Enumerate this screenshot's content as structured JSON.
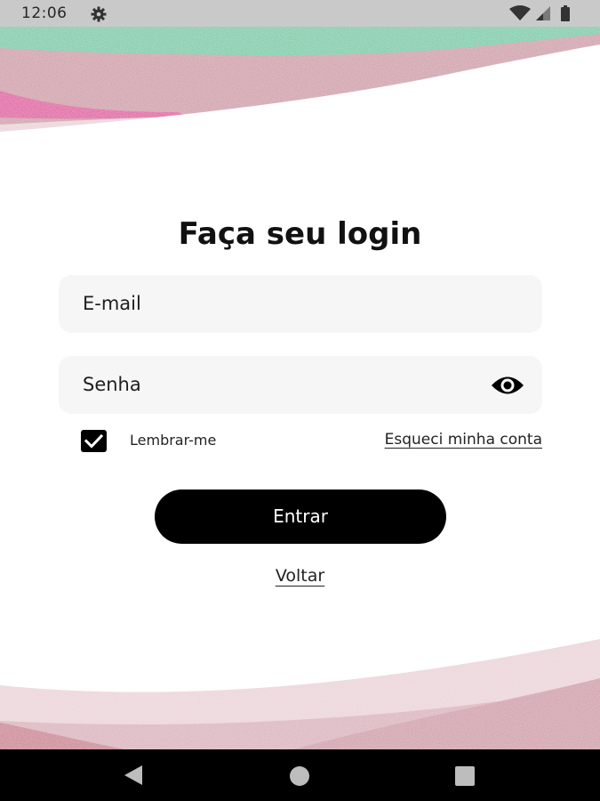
{
  "status_bar": {
    "time": "12:06",
    "icons": [
      "settings-gear-icon",
      "wifi-icon",
      "signal-icon",
      "battery-icon"
    ]
  },
  "login": {
    "title": "Faça seu login",
    "email_placeholder": "E-mail",
    "password_placeholder": "Senha",
    "remember_label": "Lembrar-me",
    "remember_checked": true,
    "forgot_link": "Esqueci minha conta",
    "submit_label": "Entrar",
    "back_link": "Voltar"
  },
  "nav_bar": {
    "buttons": [
      "back-triangle-icon",
      "home-circle-icon",
      "recents-square-icon"
    ]
  },
  "colors": {
    "status_bar": "#c9c9c9",
    "field_background": "#f6f6f6",
    "button": "#000000",
    "wave_teal": "#6fc9a4",
    "wave_pink": "#cf9aa6",
    "wave_magenta": "#e0489c",
    "wave_light_pink": "#ebd3d8"
  }
}
